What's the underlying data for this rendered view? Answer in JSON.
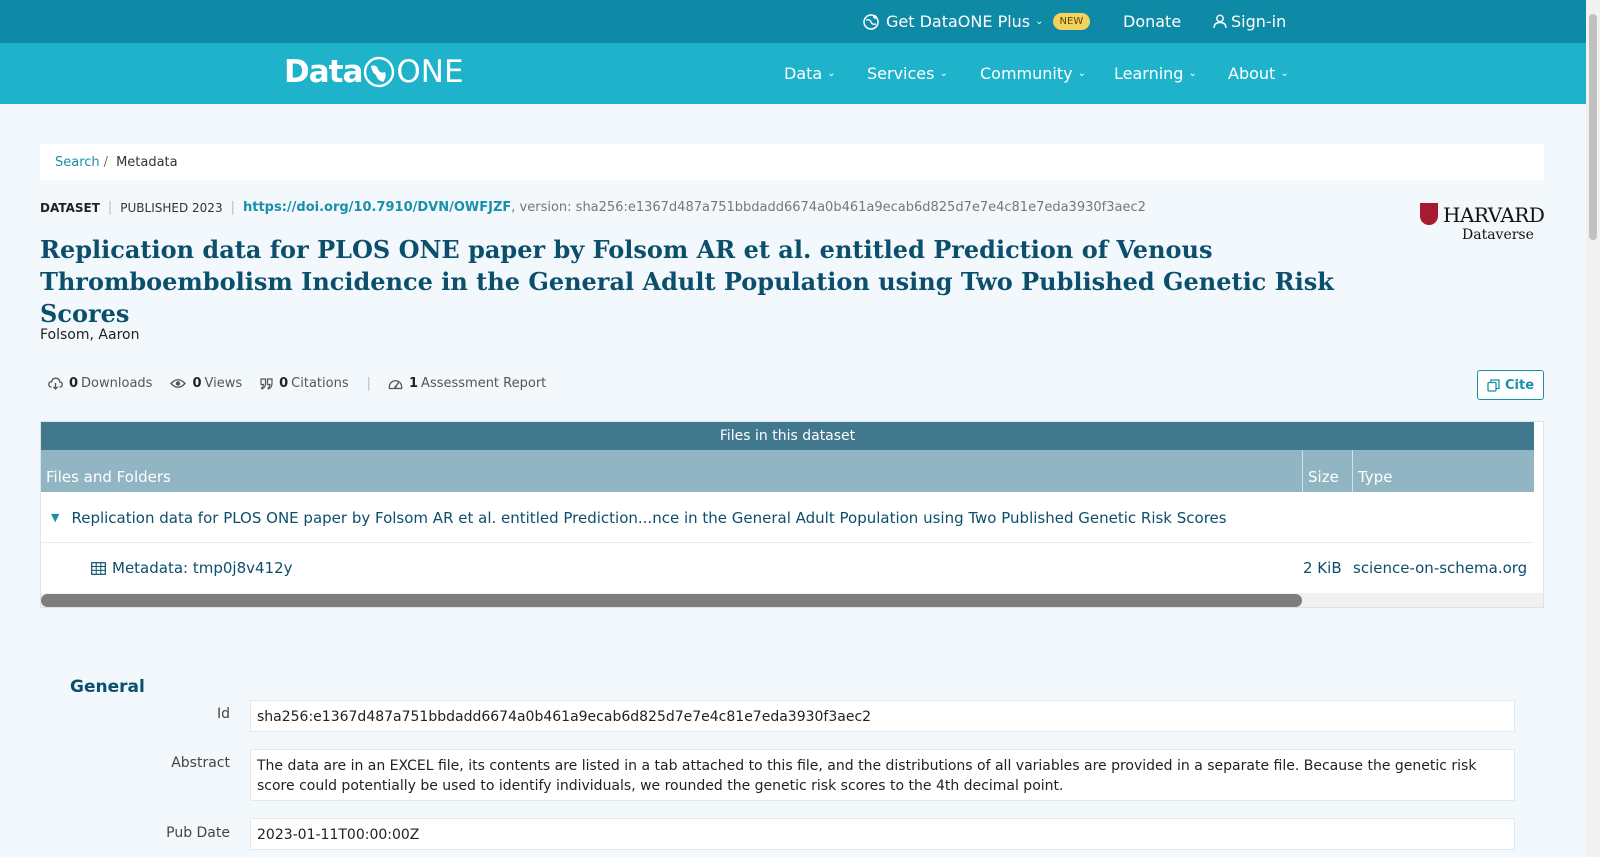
{
  "topbar": {
    "plus_label": "Get DataONE Plus",
    "badge": "NEW",
    "donate": "Donate",
    "signin": "Sign-in"
  },
  "logo": {
    "data": "Data",
    "one": "ONE"
  },
  "nav": {
    "items": [
      {
        "label": "Data"
      },
      {
        "label": "Services"
      },
      {
        "label": "Community"
      },
      {
        "label": "Learning"
      },
      {
        "label": "About"
      }
    ]
  },
  "breadcrumb": {
    "search": "Search",
    "sep": "/",
    "current": "Metadata"
  },
  "meta": {
    "type": "DATASET",
    "published": "PUBLISHED 2023",
    "doi": "https://doi.org/10.7910/DVN/OWFJZF",
    "version": ", version: sha256:e1367d487a751bbdadd6674a0b461a9ecab6d825d7e7e4c81e7eda3930f3aec2"
  },
  "repository": {
    "name": "HARVARD",
    "sub": "Dataverse"
  },
  "title": "Replication data for PLOS ONE paper by Folsom AR et al. entitled Prediction of Venous Thromboembolism Incidence in the General Adult Population using Two Published Genetic Risk Scores",
  "author": "Folsom, Aaron",
  "stats": {
    "downloads_count": "0",
    "downloads_label": "Downloads",
    "views_count": "0",
    "views_label": "Views",
    "citations_count": "0",
    "citations_label": "Citations",
    "assessment_count": "1",
    "assessment_label": "Assessment Report"
  },
  "cite_label": "Cite",
  "files": {
    "heading": "Files in this dataset",
    "columns": [
      "Files and Folders",
      "Size",
      "Type"
    ],
    "folder": "Replication data for PLOS ONE paper by Folsom AR et al. entitled Prediction...nce in the General Adult Population using Two Published Genetic Risk Scores",
    "file": {
      "name": "Metadata: tmp0j8v412y",
      "size": "2 KiB",
      "type": "science-on-schema.org"
    }
  },
  "general": {
    "heading": "General",
    "fields": [
      {
        "label": "Id",
        "value": "sha256:e1367d487a751bbdadd6674a0b461a9ecab6d825d7e7e4c81e7eda3930f3aec2"
      },
      {
        "label": "Abstract",
        "value": "The data are in an EXCEL file, its contents are listed in a tab attached to this file, and the distributions of all variables are provided in a separate file. Because the genetic risk score could potentially be used to identify individuals, we rounded the genetic risk scores to the 4th decimal point."
      },
      {
        "label": "Pub Date",
        "value": "2023-01-11T00:00:00Z"
      }
    ]
  },
  "colors": {
    "topbar": "#0f8aa6",
    "navbar": "#1eb3cb",
    "title": "#0c4f6c",
    "link": "#1a8fa8",
    "table_head": "#41788e",
    "col_head": "#91b5c3"
  }
}
